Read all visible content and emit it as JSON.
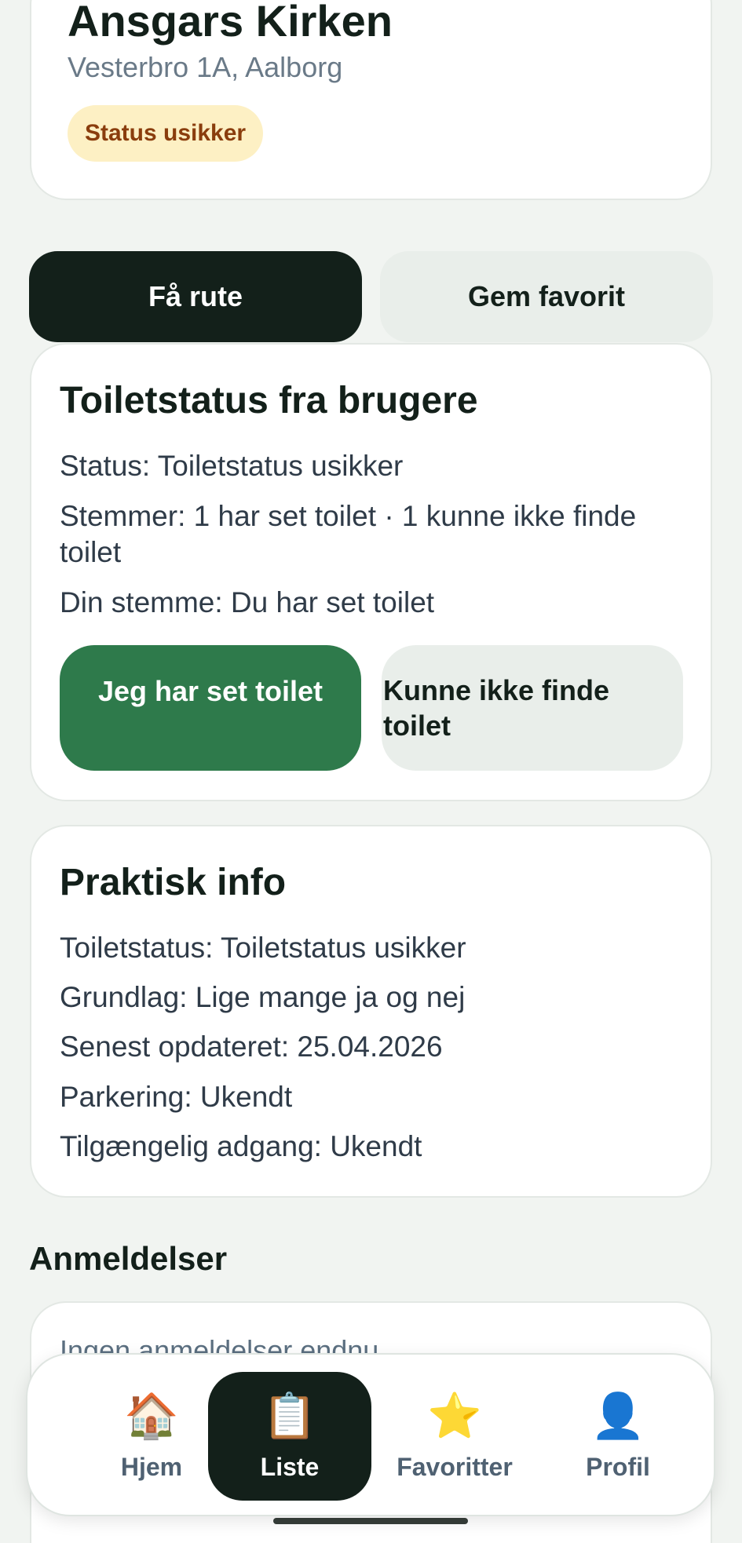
{
  "place": {
    "name": "Ansgars Kirken",
    "address": "Vesterbro 1A, Aalborg",
    "status_badge": "Status usikker"
  },
  "actions": {
    "route": "Få rute",
    "favorite": "Gem favorit"
  },
  "votes_card": {
    "title": "Toiletstatus fra brugere",
    "status_line": "Status: Toiletstatus usikker",
    "votes_line": "Stemmer: 1 har set toilet · 1 kunne ikke finde toilet",
    "my_vote_line": "Din stemme: Du har set toilet",
    "seen_button": "Jeg har set toilet",
    "not_found_button": "Kunne ikke finde toilet"
  },
  "info_card": {
    "title": "Praktisk info",
    "lines": [
      "Toiletstatus: Toiletstatus usikker",
      "Grundlag: Lige mange ja og nej",
      "Senest opdateret: 25.04.2026",
      "Parkering: Ukendt",
      "Tilgængelig adgang: Ukendt"
    ]
  },
  "reviews": {
    "heading": "Anmeldelser",
    "empty_text": "Ingen anmeldelser endnu"
  },
  "bottom_nav": {
    "active": "Liste",
    "items": [
      {
        "label": "Hjem",
        "icon": "🏠",
        "icon_name": "house-icon"
      },
      {
        "label": "Liste",
        "icon": "📋",
        "icon_name": "clipboard-icon"
      },
      {
        "label": "Favoritter",
        "icon": "⭐",
        "icon_name": "star-icon"
      },
      {
        "label": "Profil",
        "icon": "👤",
        "icon_name": "person-icon"
      }
    ]
  },
  "colors": {
    "primary_dark": "#13201a",
    "vote_green": "#2e7a4b",
    "badge_bg": "#fdf0c4",
    "badge_text": "#8a3d0d"
  }
}
